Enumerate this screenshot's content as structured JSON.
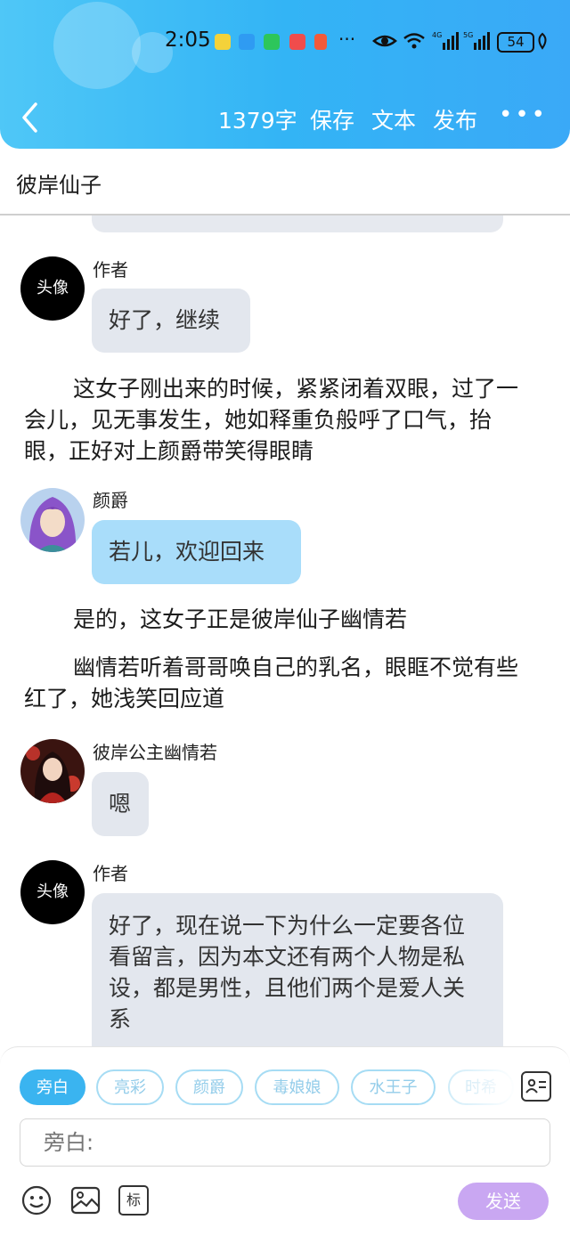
{
  "status": {
    "time": "2:05",
    "battery": "54",
    "net1": "4G",
    "net2": "5G"
  },
  "nav": {
    "word_count": "1379字",
    "save": "保存",
    "text": "文本",
    "publish": "发布"
  },
  "title": "彼岸仙子",
  "messages": [
    {
      "name": "作者",
      "avatar_text": "头像",
      "text": "好了，继续"
    },
    {
      "narration": "这女子刚出来的时候，紧紧闭着双眼，过了一会儿，见无事发生，她如释重负般呼了口气，抬眼，正好对上颜爵带笑得眼睛"
    },
    {
      "name": "颜爵",
      "text": "若儿，欢迎回来"
    },
    {
      "narration": "是的，这女子正是彼岸仙子幽情若"
    },
    {
      "narration": "幽情若听着哥哥唤自己的乳名，眼眶不觉有些红了，她浅笑回应道"
    },
    {
      "name": "彼岸公主幽情若",
      "text": "嗯"
    },
    {
      "name": "作者",
      "avatar_text": "头像",
      "text": "好了，现在说一下为什么一定要各位看留言，因为本文还有两个人物是私设，都是男性，且他们两个是爱人关系"
    }
  ],
  "roles": [
    "旁白",
    "亮彩",
    "颜爵",
    "毒娘娘",
    "水王子",
    "时希"
  ],
  "input": {
    "placeholder": "旁白:"
  },
  "tools": {
    "tag_label": "标",
    "send": "发送"
  },
  "colors": {
    "header": "#3ab4f0",
    "chip_active": "#3ab4f0",
    "send": "#c9a7f2",
    "bubble_gray": "#e3e7ee",
    "bubble_blue": "#a9ddfa"
  }
}
